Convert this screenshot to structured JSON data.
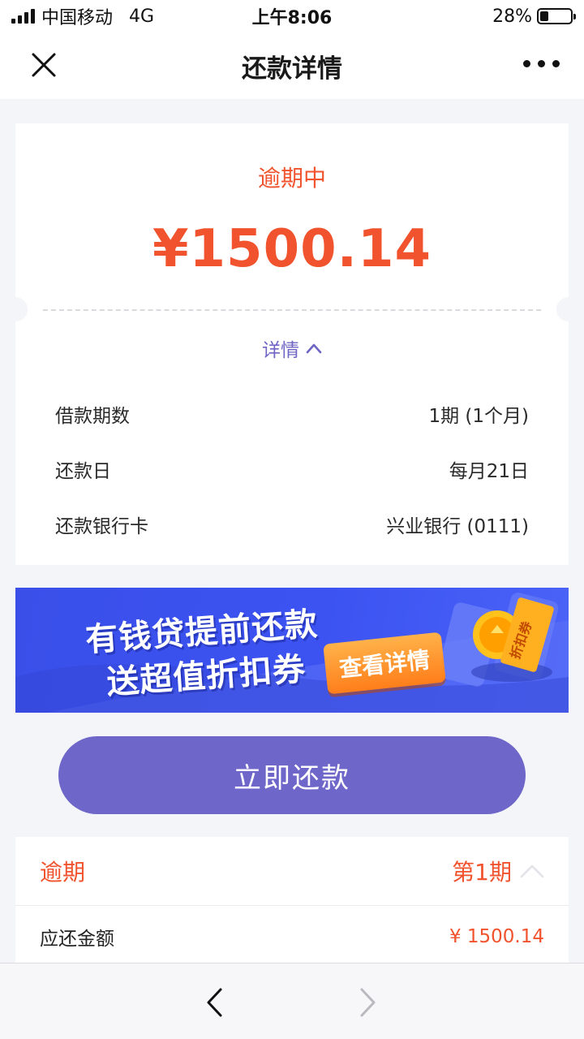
{
  "status_bar": {
    "carrier": "中国移动",
    "network": "4G",
    "time": "上午8:06",
    "battery_percent_text": "28%",
    "battery_level": 0.28
  },
  "nav": {
    "title": "还款详情",
    "close_icon": "close-icon",
    "more_icon": "more-icon"
  },
  "summary": {
    "status": "逾期中",
    "amount": "¥1500.14",
    "detail_toggle": "详情",
    "rows": [
      {
        "label": "借款期数",
        "value": "1期 (1个月)"
      },
      {
        "label": "还款日",
        "value": "每月21日"
      },
      {
        "label": "还款银行卡",
        "value": "兴业银行 (0111)"
      }
    ]
  },
  "banner": {
    "line1": "有钱贷提前还款",
    "line2": "送超值折扣券",
    "button": "查看详情",
    "coupon_text": "折扣券"
  },
  "actions": {
    "repay_label": "立即还款"
  },
  "period": {
    "status": "逾期",
    "number": "第1期",
    "due_label": "应还金额",
    "due_value": "¥ 1500.14"
  },
  "colors": {
    "accent_red": "#f0532d",
    "primary_purple": "#6e66c8",
    "banner_blue": "#3c53f2",
    "background": "#f4f5f9"
  }
}
